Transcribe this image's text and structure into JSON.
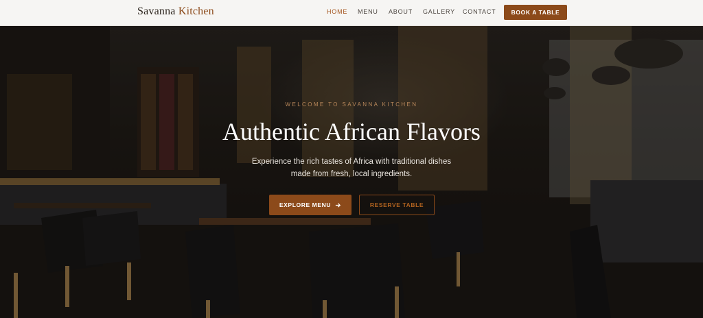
{
  "navbar": {
    "logo_primary": "Savanna",
    "logo_accent": "Kitchen",
    "links": [
      {
        "label": "HOME"
      },
      {
        "label": "MENU"
      },
      {
        "label": "ABOUT"
      },
      {
        "label": "GALLERY"
      },
      {
        "label": "CONTACT"
      }
    ],
    "active": "HOME",
    "book_label": "BOOK A TABLE"
  },
  "hero": {
    "eyebrow": "WELCOME TO SAVANNA KITCHEN",
    "title": "Authentic African Flavors",
    "subtitle": "Experience the rich tastes of Africa with traditional dishes made from fresh, local ingredients.",
    "explore_label": "EXPLORE MENU",
    "explore_icon": "arrow-right-icon",
    "reserve_label": "RESERVE TABLE",
    "background": "restaurant-interior-photo"
  },
  "colors": {
    "accent": "#8c4a1a",
    "active_link": "#a4561f",
    "nav_bg": "#f6f5f3",
    "eyebrow": "#b8875a"
  }
}
